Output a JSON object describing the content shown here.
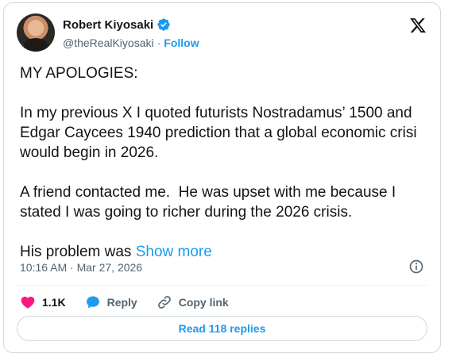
{
  "author": {
    "display_name": "Robert Kiyosaki",
    "handle": "@theRealKiyosaki",
    "separator": "·",
    "follow_label": "Follow"
  },
  "tweet": {
    "text": "MY APOLOGIES:\n\nIn my previous X I quoted futurists Nostradamus’ 1500 and Edgar Caycees 1940 prediction that a global economic crisi would begin in 2026.\n\nA friend contacted me.  He was upset with me because I stated I was going to richer during the 2026 crisis.\n\nHis problem was ",
    "show_more_label": "Show more",
    "timestamp": "10:16 AM · Mar 27, 2026"
  },
  "actions": {
    "likes": "1.1K",
    "reply_label": "Reply",
    "copy_link_label": "Copy link"
  },
  "replies_button": "Read 118 replies",
  "colors": {
    "accent": "#1d9bf0",
    "like": "#f91880",
    "text": "#0f1419",
    "muted": "#536471"
  },
  "icons": {
    "brand": "x-logo-icon",
    "verified": "verified-badge-icon",
    "info": "info-icon",
    "like": "heart-icon",
    "reply": "reply-bubble-icon",
    "copy": "link-icon"
  }
}
